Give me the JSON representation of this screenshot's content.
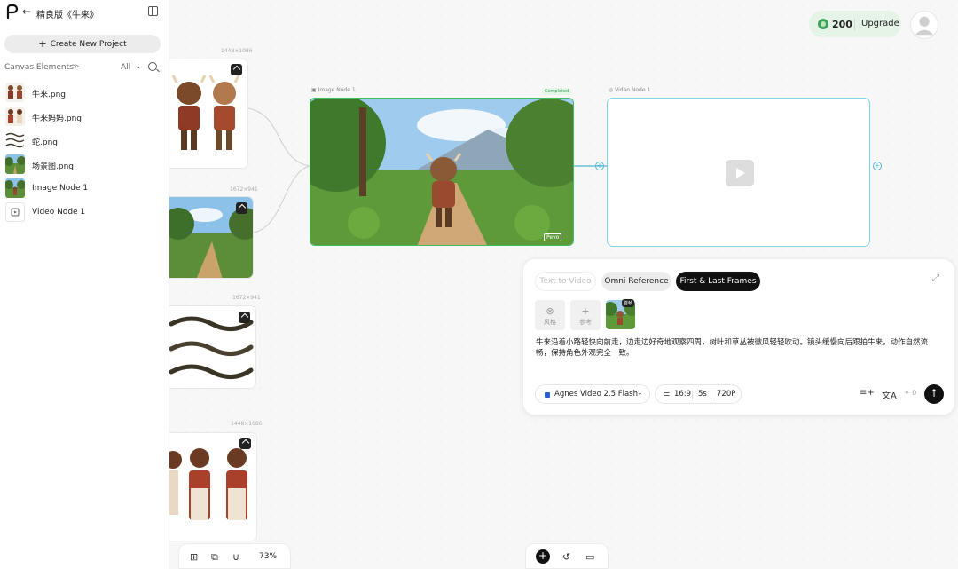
{
  "sidebar": {
    "title": "精良版《牛来》",
    "new_project": "Create New Project",
    "canvas_elements_label": "Canvas Elements",
    "filter": "All",
    "items": [
      {
        "label": "牛来.png",
        "thumb": "cow-chars"
      },
      {
        "label": "牛来妈妈.png",
        "thumb": "mom-chars"
      },
      {
        "label": "蛇.png",
        "thumb": "snakes"
      },
      {
        "label": "场景图.png",
        "thumb": "scene"
      },
      {
        "label": "Image Node 1",
        "thumb": "scene-cow"
      },
      {
        "label": "Video Node 1",
        "thumb": "video-icon"
      }
    ]
  },
  "topbar": {
    "credits": "200",
    "upgrade": "Upgrade"
  },
  "canvas": {
    "dims": [
      "1448×1086",
      "1672×941",
      "1672×941",
      "1448×1086"
    ],
    "image_node_label": "Image Node 1",
    "image_node_status": "Completed",
    "video_node_label": "Video Node 1",
    "watermark": "Pevo"
  },
  "prompt_panel": {
    "tabs": [
      "Text to Video",
      "Omni Reference",
      "First & Last Frames"
    ],
    "active_tab": "First & Last Frames",
    "options": [
      {
        "icon": "style-icon",
        "label": "风格"
      },
      {
        "icon": "plus-icon",
        "label": "参考"
      }
    ],
    "reference_tag": "首帧",
    "prompt": "牛来沿着小路轻快向前走，边走边好奇地观察四周，树叶和草丛被微风轻轻吹动。镜头缓慢向后跟拍牛来，动作自然流畅，保持角色外观完全一致。",
    "model": "Agnes Video 2.5 Flash",
    "aspect": "16:9",
    "duration": "5s",
    "resolution": "720P",
    "cost": "0"
  },
  "bottom": {
    "zoom": "73%"
  },
  "colors": {
    "accent_green": "#3fbf5e",
    "video_border": "#7fd4e6",
    "credits_bg": "#e6f4e8"
  }
}
